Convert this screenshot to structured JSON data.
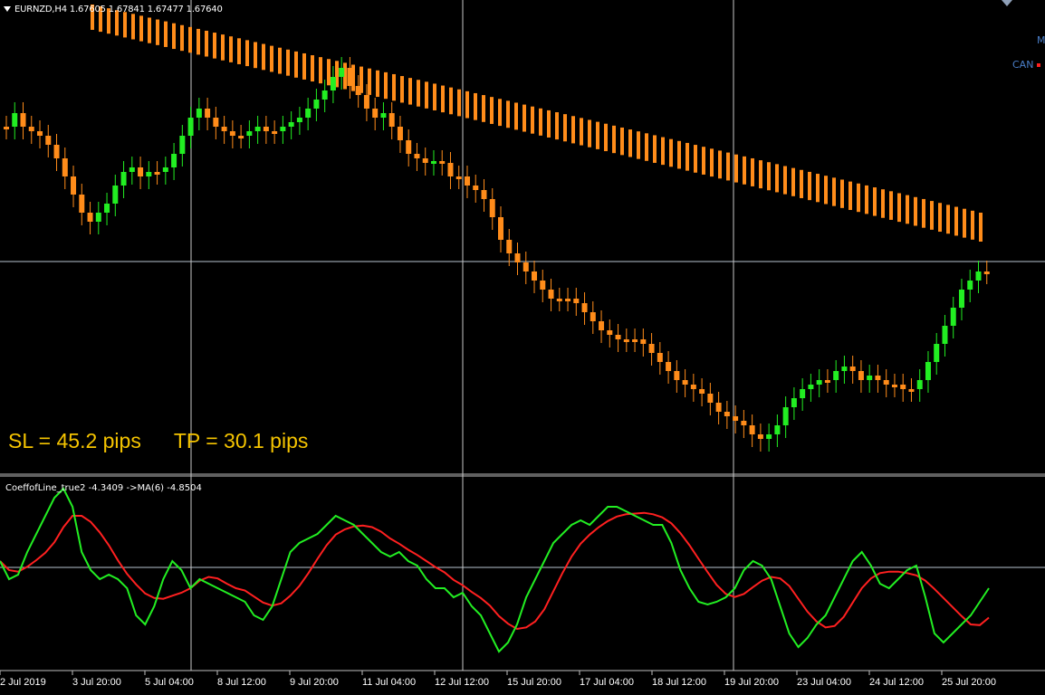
{
  "window": {
    "symbol_header": "EURNZD,H4  1.67605 1.67841 1.67477 1.67640",
    "indicator_header": "CoeffofLine_true2 -4.3409  ->MA(6) -4.8504",
    "sl_text": "SL = 45.2 pips",
    "tp_text": "TP = 30.1 pips",
    "legend_m": "M",
    "legend_can": "CAN"
  },
  "colors": {
    "background": "#000000",
    "bull": "#22ee22",
    "bear": "#ff8c1a",
    "envelope": "#ff8c1a",
    "coeff_line": "#22ee22",
    "ma_line": "#ff2020",
    "crosshair": "#c8c8c8",
    "sltp_text": "#f5c400"
  },
  "x_axis_labels": [
    "2 Jul 2019",
    "3 Jul 20:00",
    "5 Jul 04:00",
    "8 Jul 12:00",
    "9 Jul 20:00",
    "11 Jul 04:00",
    "12 Jul 12:00",
    "15 Jul 20:00",
    "17 Jul 04:00",
    "18 Jul 12:00",
    "19 Jul 20:00",
    "23 Jul 04:00",
    "24 Jul 12:00",
    "25 Jul 20:00"
  ],
  "chart_data": {
    "type": "candlestick",
    "symbol": "EURNZD",
    "timeframe": "H4",
    "candles_close_trend": [
      140,
      125,
      140,
      145,
      150,
      160,
      175,
      195,
      215,
      235,
      245,
      235,
      225,
      205,
      190,
      185,
      195,
      190,
      190,
      185,
      170,
      150,
      130,
      120,
      130,
      140,
      145,
      150,
      150,
      145,
      140,
      145,
      145,
      140,
      135,
      130,
      120,
      110,
      100,
      85,
      75,
      95,
      105,
      120,
      130,
      125,
      140,
      155,
      170,
      175,
      180,
      178,
      180,
      195,
      195,
      205,
      210,
      220,
      240,
      265,
      280,
      290,
      300,
      310,
      320,
      330,
      330,
      330,
      335,
      345,
      355,
      365,
      370,
      375,
      375,
      375,
      380,
      390,
      400,
      410,
      420,
      425,
      430,
      435,
      445,
      455,
      460,
      465,
      470,
      480,
      485,
      480,
      470,
      450,
      440,
      430,
      425,
      420,
      420,
      410,
      405,
      410,
      420,
      415,
      420,
      425,
      425,
      430,
      430,
      420,
      400,
      380,
      360,
      340,
      320,
      310,
      300,
      300
    ],
    "envelope_top_trend": [
      0,
      0,
      0,
      0,
      0,
      0,
      0,
      0,
      0,
      0,
      0,
      0,
      0,
      0,
      0,
      0,
      0,
      0,
      0,
      0,
      0,
      0,
      0,
      0,
      0,
      0,
      0,
      0,
      0,
      0,
      0,
      0,
      0,
      0,
      0,
      0,
      0,
      0,
      0,
      0,
      0,
      0,
      0,
      0,
      0,
      0,
      0,
      0,
      0,
      0,
      0,
      0,
      0,
      0,
      0,
      0,
      0,
      0,
      0,
      0,
      0,
      0,
      0,
      0,
      0,
      0,
      0,
      0,
      0,
      0,
      0,
      0,
      0,
      0,
      0,
      0,
      0,
      0,
      0,
      0,
      0,
      0,
      0,
      0,
      0,
      0,
      0,
      0,
      0,
      0,
      0,
      0,
      0,
      0,
      0,
      0,
      0,
      0,
      0,
      0,
      0,
      0,
      0,
      0,
      0,
      0,
      0,
      0,
      0,
      0,
      0,
      0,
      0,
      0,
      0,
      0,
      0,
      0,
      0
    ],
    "indicator": {
      "name": "CoeffofLine_true2",
      "value": -4.3409,
      "ma_name": "MA(6)",
      "ma_value": -4.8504,
      "coeff_series": [
        620,
        640,
        635,
        610,
        590,
        570,
        550,
        540,
        560,
        610,
        630,
        640,
        635,
        640,
        650,
        680,
        690,
        670,
        640,
        620,
        630,
        650,
        640,
        645,
        650,
        655,
        660,
        665,
        680,
        685,
        670,
        640,
        610,
        600,
        595,
        590,
        580,
        570,
        575,
        580,
        590,
        600,
        610,
        615,
        610,
        620,
        625,
        640,
        650,
        650,
        660,
        655,
        670,
        680,
        700,
        720,
        710,
        690,
        660,
        640,
        620,
        600,
        590,
        580,
        575,
        580,
        570,
        560,
        560,
        565,
        570,
        575,
        580,
        580,
        600,
        630,
        650,
        665,
        668,
        665,
        660,
        650,
        630,
        620,
        625,
        640,
        670,
        700,
        715,
        705,
        690,
        680,
        660,
        640,
        620,
        610,
        625,
        645,
        650,
        640,
        630,
        625,
        660,
        700,
        710,
        700,
        690,
        680,
        665,
        650
      ],
      "ma_series": []
    }
  }
}
